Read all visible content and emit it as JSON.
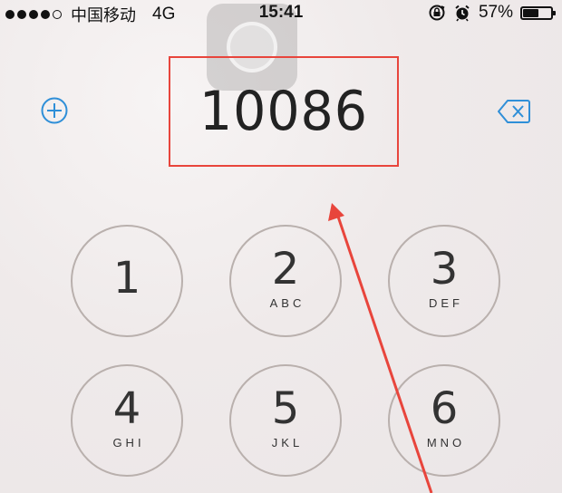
{
  "status_bar": {
    "signal_dots": [
      true,
      true,
      true,
      true,
      false
    ],
    "carrier": "中国移动",
    "network": "4G",
    "time": "15:41",
    "battery_percent": "57%",
    "battery_level": 0.57,
    "icons": [
      "rotation-lock-icon",
      "alarm-icon"
    ]
  },
  "dialer": {
    "number": "10086",
    "add_contact_icon": "plus-circle-icon",
    "delete_icon": "backspace-icon",
    "accent_color": "#2f8fd8",
    "highlight_color": "#e8453c"
  },
  "keypad": [
    {
      "digit": "1",
      "letters": ""
    },
    {
      "digit": "2",
      "letters": "ABC"
    },
    {
      "digit": "3",
      "letters": "DEF"
    },
    {
      "digit": "4",
      "letters": "GHI"
    },
    {
      "digit": "5",
      "letters": "JKL"
    },
    {
      "digit": "6",
      "letters": "MNO"
    }
  ]
}
